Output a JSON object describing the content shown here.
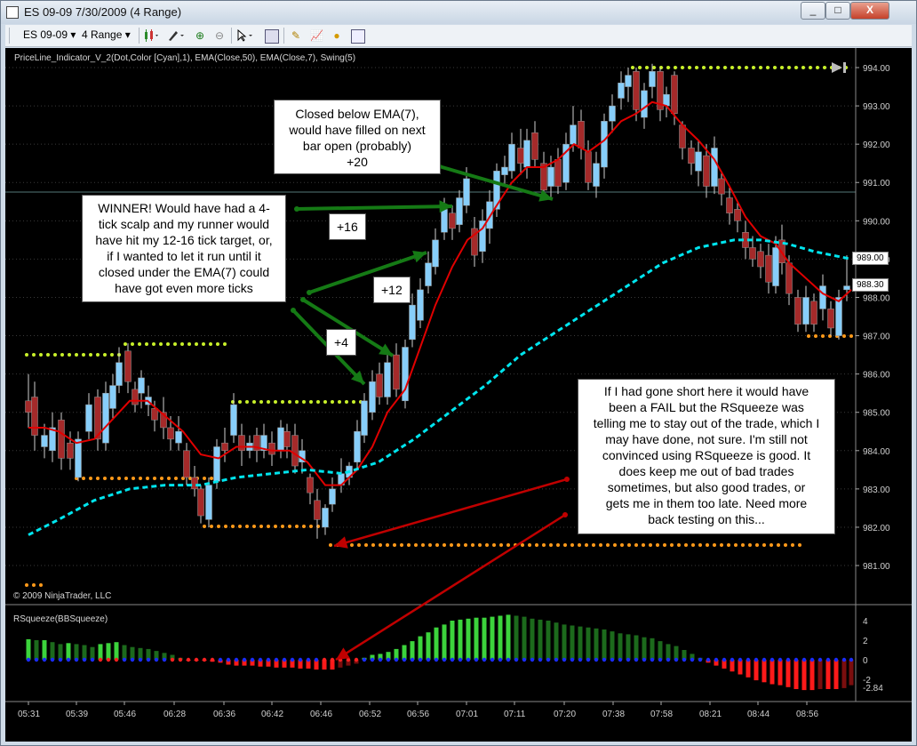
{
  "window": {
    "title": "ES 09-09  7/30/2009 (4 Range)",
    "minimize_label": "_",
    "maximize_label": "□",
    "close_label": "X"
  },
  "toolbar": {
    "instrument": "ES 09-09",
    "instrument_arrow": "▾",
    "period": "4 Range",
    "period_arrow": "▾"
  },
  "chart": {
    "indicator_label": "PriceLine_Indicator_V_2(Dot,Color [Cyan],1), EMA(Close,50), EMA(Close,7), Swing(5)",
    "copyright": "© 2009 NinjaTrader, LLC",
    "squeeze_label": "RSqueeze(BBSqueeze)",
    "price_axis": [
      "994.00",
      "993.00",
      "992.00",
      "991.00",
      "990.00",
      "989.00",
      "988.00",
      "987.00",
      "986.00",
      "985.00",
      "984.00",
      "983.00",
      "982.00",
      "981.00"
    ],
    "price_tags": [
      "989.00",
      "988.30"
    ],
    "squeeze_axis": [
      "4",
      "2",
      "0",
      "-2",
      "-2.84"
    ],
    "time_axis": [
      "05:31",
      "05:39",
      "05:46",
      "06:28",
      "06:36",
      "06:42",
      "06:46",
      "06:52",
      "06:56",
      "07:01",
      "07:11",
      "07:20",
      "07:38",
      "07:58",
      "08:21",
      "08:44",
      "08:56"
    ]
  },
  "annotations": {
    "closed_below": [
      "Closed below EMA(7),",
      "would have filled on next",
      "bar open (probably)",
      "+20"
    ],
    "winner": [
      "WINNER!  Would have had a 4-",
      "tick scalp and my runner would",
      "have hit my 12-16 tick target, or,",
      "if I wanted to let it run until it",
      "closed under the EMA(7) could",
      "have got even more ticks"
    ],
    "plus16": "+16",
    "plus12": "+12",
    "plus4": "+4",
    "rsqueeze_note": [
      "If I had gone short here it would have",
      "been a FAIL but the RSqueeze was",
      "telling me to stay out of the trade, which I",
      "may have done, not sure.  I'm still not",
      "convinced using RSqueeze is good.  It",
      "does keep me out of bad trades",
      "sometimes, but also good trades, or",
      "gets me in them too late.  Need more",
      "back testing on this..."
    ]
  },
  "colors": {
    "up_candle": "#87cefa",
    "down_candle": "#a52a2a",
    "ema7": "#e00000",
    "ema50": "#00e5ee",
    "swing_high": "#c8f02a",
    "swing_low": "#ff9a1a",
    "arrow_green": "#157a15",
    "arrow_red": "#c00000"
  }
}
